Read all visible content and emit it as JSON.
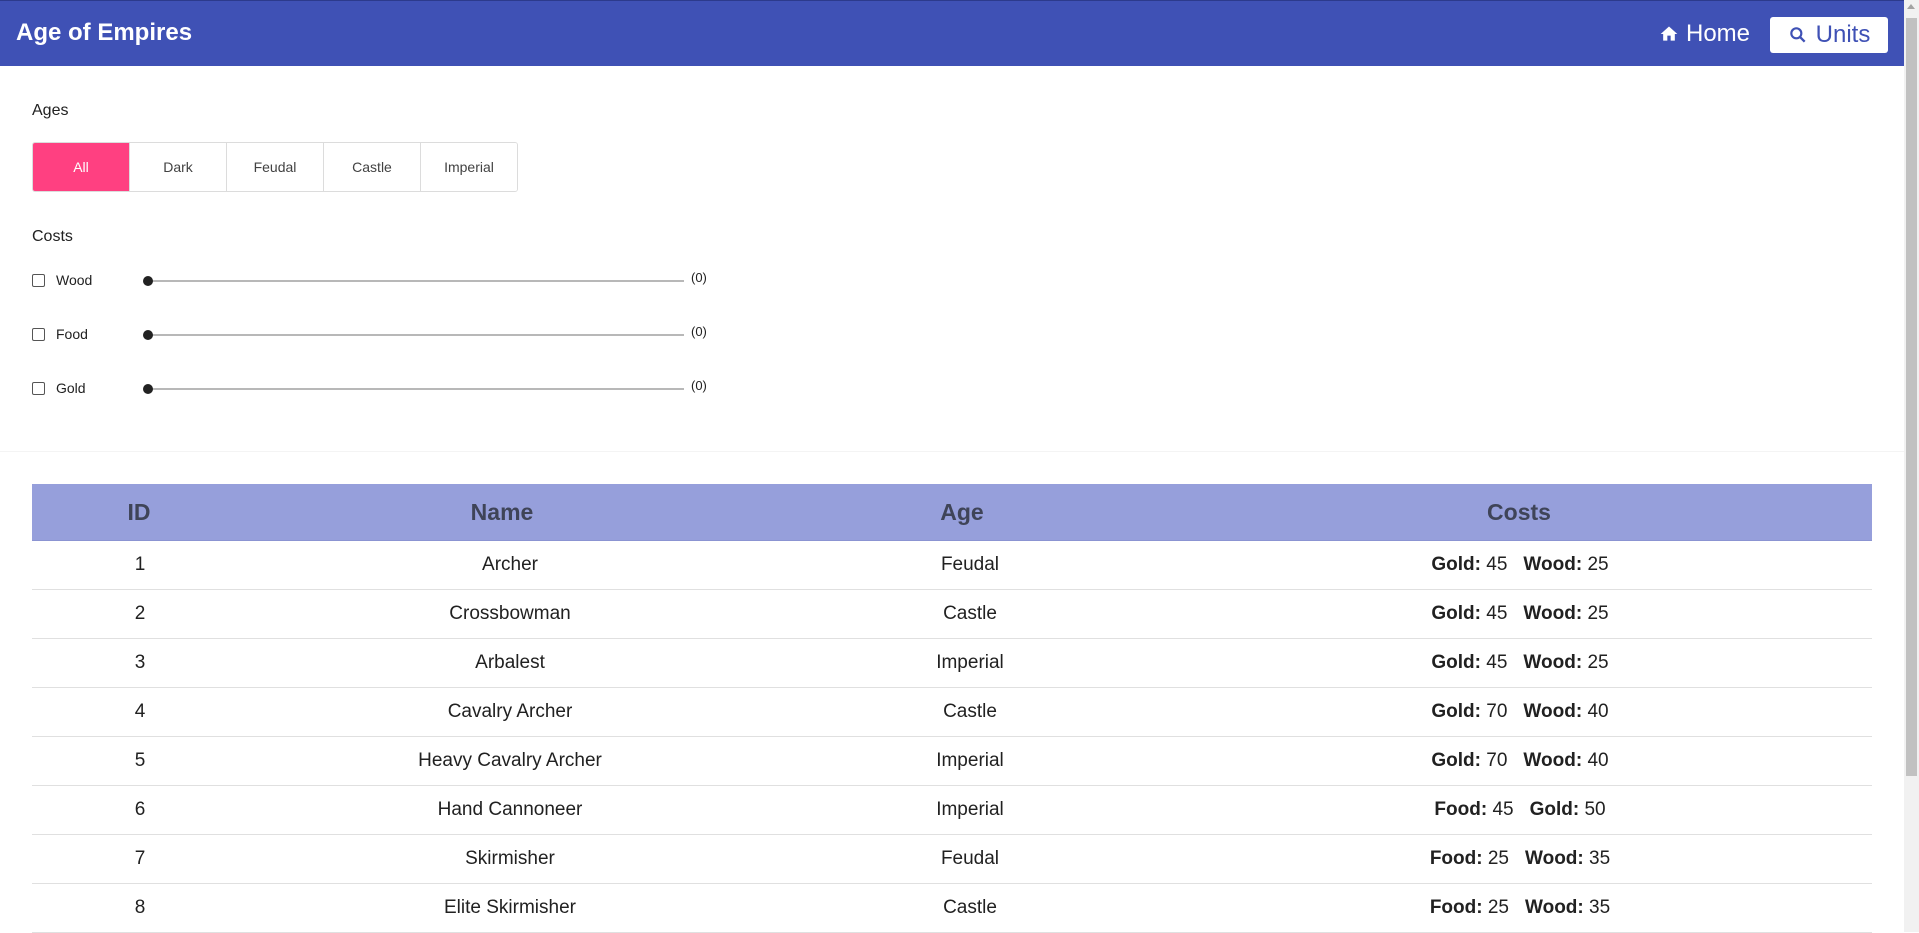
{
  "app": {
    "title": "Age of Empires",
    "nav": {
      "home_label": "Home",
      "units_label": "Units"
    },
    "colors": {
      "appbar": "#3f51b5",
      "accent": "#ff4081",
      "table_header": "#969fdb"
    }
  },
  "filters": {
    "ages_label": "Ages",
    "ages": [
      "All",
      "Dark",
      "Feudal",
      "Castle",
      "Imperial"
    ],
    "selected_age": "All",
    "costs_label": "Costs",
    "costs": [
      {
        "name": "Wood",
        "checked": false,
        "value": "(0)"
      },
      {
        "name": "Food",
        "checked": false,
        "value": "(0)"
      },
      {
        "name": "Gold",
        "checked": false,
        "value": "(0)"
      }
    ]
  },
  "table": {
    "headers": [
      "ID",
      "Name",
      "Age",
      "Costs"
    ],
    "rows": [
      {
        "id": "1",
        "name": "Archer",
        "age": "Feudal",
        "costs": [
          {
            "k": "Gold:",
            "v": "45"
          },
          {
            "k": "Wood:",
            "v": "25"
          }
        ]
      },
      {
        "id": "2",
        "name": "Crossbowman",
        "age": "Castle",
        "costs": [
          {
            "k": "Gold:",
            "v": "45"
          },
          {
            "k": "Wood:",
            "v": "25"
          }
        ]
      },
      {
        "id": "3",
        "name": "Arbalest",
        "age": "Imperial",
        "costs": [
          {
            "k": "Gold:",
            "v": "45"
          },
          {
            "k": "Wood:",
            "v": "25"
          }
        ]
      },
      {
        "id": "4",
        "name": "Cavalry Archer",
        "age": "Castle",
        "costs": [
          {
            "k": "Gold:",
            "v": "70"
          },
          {
            "k": "Wood:",
            "v": "40"
          }
        ]
      },
      {
        "id": "5",
        "name": "Heavy Cavalry Archer",
        "age": "Imperial",
        "costs": [
          {
            "k": "Gold:",
            "v": "70"
          },
          {
            "k": "Wood:",
            "v": "40"
          }
        ]
      },
      {
        "id": "6",
        "name": "Hand Cannoneer",
        "age": "Imperial",
        "costs": [
          {
            "k": "Food:",
            "v": "45"
          },
          {
            "k": "Gold:",
            "v": "50"
          }
        ]
      },
      {
        "id": "7",
        "name": "Skirmisher",
        "age": "Feudal",
        "costs": [
          {
            "k": "Food:",
            "v": "25"
          },
          {
            "k": "Wood:",
            "v": "35"
          }
        ]
      },
      {
        "id": "8",
        "name": "Elite Skirmisher",
        "age": "Castle",
        "costs": [
          {
            "k": "Food:",
            "v": "25"
          },
          {
            "k": "Wood:",
            "v": "35"
          }
        ]
      }
    ]
  }
}
